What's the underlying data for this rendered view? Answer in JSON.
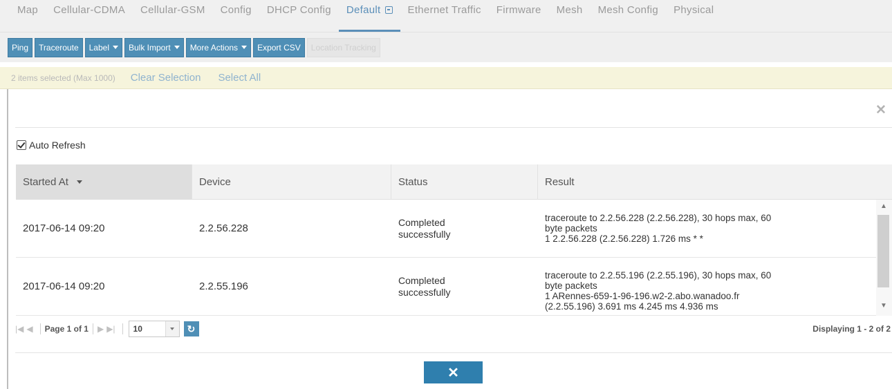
{
  "tabs": [
    {
      "label": "Map"
    },
    {
      "label": "Cellular-CDMA"
    },
    {
      "label": "Cellular-GSM"
    },
    {
      "label": "Config"
    },
    {
      "label": "DHCP Config"
    },
    {
      "label": "Default",
      "active": true
    },
    {
      "label": "Ethernet Traffic"
    },
    {
      "label": "Firmware"
    },
    {
      "label": "Mesh"
    },
    {
      "label": "Mesh Config"
    },
    {
      "label": "Physical"
    }
  ],
  "toolbar": {
    "ping": "Ping",
    "traceroute": "Traceroute",
    "label": "Label",
    "bulk_import": "Bulk Import",
    "more_actions": "More Actions",
    "export_csv": "Export CSV",
    "location_tracking": "Location Tracking"
  },
  "selection": {
    "info": "2 items selected (Max 1000)",
    "clear": "Clear Selection",
    "select_all": "Select All"
  },
  "dialog": {
    "auto_refresh": "Auto Refresh",
    "columns": [
      "Started At",
      "Device",
      "Status",
      "Result"
    ],
    "rows": [
      {
        "started_at": "2017-06-14 09:20",
        "device": "2.2.56.228",
        "status_line1": "Completed",
        "status_line2": "successfully",
        "result_lines": [
          "traceroute to 2.2.56.228 (2.2.56.228), 30 hops max, 60",
          "byte packets",
          "1 2.2.56.228 (2.2.56.228) 1.726 ms * *"
        ]
      },
      {
        "started_at": "2017-06-14 09:20",
        "device": "2.2.55.196",
        "status_line1": "Completed",
        "status_line2": "successfully",
        "result_lines": [
          "traceroute to 2.2.55.196 (2.2.55.196), 30 hops max, 60",
          "byte packets",
          "1 ARennes-659-1-96-196.w2-2.abo.wanadoo.fr",
          "(2.2.55.196) 3.691 ms 4.245 ms 4.936 ms"
        ]
      }
    ],
    "pager": {
      "page_label": "Page 1 of 1",
      "page_size": "10",
      "displaying": "Displaying 1 - 2 of 2"
    }
  },
  "colors": {
    "accent": "#4f8fb6",
    "close_button": "#2f7fae",
    "selection_bar": "#f6f4dc"
  }
}
